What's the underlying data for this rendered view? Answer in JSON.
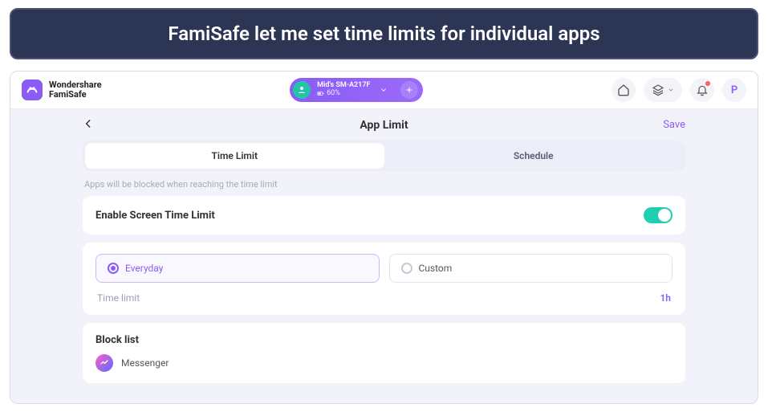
{
  "caption": "FamiSafe let me set time limits for individual apps",
  "brand": {
    "line1": "Wondershare",
    "line2": "FamiSafe"
  },
  "device": {
    "name": "Mid's SM-A217F",
    "battery": "60%"
  },
  "header": {
    "avatar_letter": "P"
  },
  "page": {
    "title": "App Limit",
    "save_label": "Save",
    "tabs": {
      "time_limit": "Time Limit",
      "schedule": "Schedule"
    },
    "hint": "Apps will be blocked when reaching the time limit",
    "enable_label": "Enable Screen Time Limit",
    "radio": {
      "everyday": "Everyday",
      "custom": "Custom"
    },
    "time_limit_label": "Time limit",
    "time_limit_value": "1h",
    "blocklist": {
      "title": "Block list",
      "items": [
        "Messenger"
      ]
    }
  }
}
